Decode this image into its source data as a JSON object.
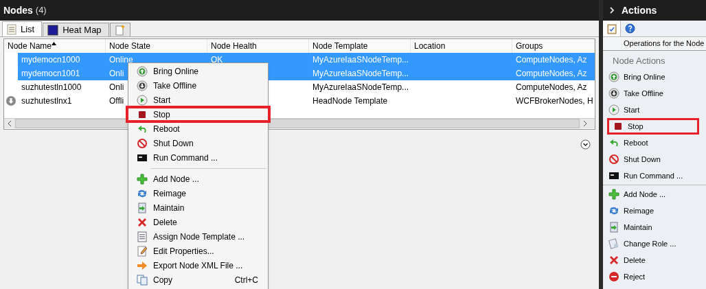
{
  "main_panel": {
    "title": "Nodes",
    "count": "(4)"
  },
  "tabs": [
    {
      "label": "List",
      "selected": true
    },
    {
      "label": "Heat Map",
      "selected": false
    },
    {
      "selected": false
    }
  ],
  "table": {
    "columns": [
      {
        "label": "Node Name",
        "sorted": true
      },
      {
        "label": "Node State",
        "sorted": false
      },
      {
        "label": "Node Health",
        "sorted": false
      },
      {
        "label": "Node Template",
        "sorted": false
      },
      {
        "label": "Location",
        "sorted": false
      },
      {
        "label": "Groups",
        "sorted": false
      }
    ],
    "rows": [
      {
        "selected": true,
        "offline": false,
        "cells": [
          "mydemocn1000",
          "Online",
          "OK",
          "MyAzureIaaSNodeTemp...",
          "",
          "ComputeNodes, Az"
        ]
      },
      {
        "selected": true,
        "offline": false,
        "cells": [
          "mydemocn1001",
          "Onli",
          "",
          "MyAzureIaaSNodeTemp...",
          "",
          "ComputeNodes, Az"
        ]
      },
      {
        "selected": false,
        "offline": false,
        "cells": [
          "suzhutestln1000",
          "Onli",
          "",
          "MyAzureIaaSNodeTemp...",
          "",
          "ComputeNodes, Az"
        ]
      },
      {
        "selected": false,
        "offline": true,
        "cells": [
          "suzhutestlnx1",
          "Offli",
          "",
          "HeadNode Template",
          "",
          "WCFBrokerNodes, H"
        ]
      }
    ]
  },
  "context_menu": {
    "groups": [
      [
        {
          "label": "Bring Online",
          "highlighted": false
        },
        {
          "label": "Take Offline",
          "highlighted": false
        },
        {
          "label": "Start",
          "highlighted": false
        },
        {
          "label": "Stop",
          "highlighted": true
        },
        {
          "label": "Reboot",
          "highlighted": false
        },
        {
          "label": "Shut Down",
          "highlighted": false
        },
        {
          "label": "Run Command ...",
          "highlighted": false
        }
      ],
      [
        {
          "label": "Add Node ...",
          "highlighted": false
        },
        {
          "label": "Reimage",
          "highlighted": false
        },
        {
          "label": "Maintain",
          "highlighted": false
        },
        {
          "label": "Delete",
          "highlighted": false
        },
        {
          "label": "Assign Node Template ...",
          "highlighted": false
        },
        {
          "label": "Edit Properties...",
          "highlighted": false
        },
        {
          "label": "Export Node XML File ...",
          "highlighted": false
        },
        {
          "label": "Copy",
          "shortcut": "Ctrl+C",
          "highlighted": false
        }
      ]
    ]
  },
  "actions_panel": {
    "title": "Actions",
    "description": "Operations for the Node",
    "section": "Node Actions",
    "groups": [
      [
        {
          "label": "Bring Online",
          "highlighted": false
        },
        {
          "label": "Take Offline",
          "highlighted": false
        },
        {
          "label": "Start",
          "highlighted": false
        },
        {
          "label": "Stop",
          "highlighted": true
        },
        {
          "label": "Reboot",
          "highlighted": false
        },
        {
          "label": "Shut Down",
          "highlighted": false
        },
        {
          "label": "Run Command ...",
          "highlighted": false
        }
      ],
      [
        {
          "label": "Add Node ...",
          "highlighted": false
        },
        {
          "label": "Reimage",
          "highlighted": false
        },
        {
          "label": "Maintain",
          "highlighted": false
        },
        {
          "label": "Change Role ...",
          "highlighted": false
        },
        {
          "label": "Delete",
          "highlighted": false
        },
        {
          "label": "Reject",
          "highlighted": false
        }
      ]
    ]
  }
}
